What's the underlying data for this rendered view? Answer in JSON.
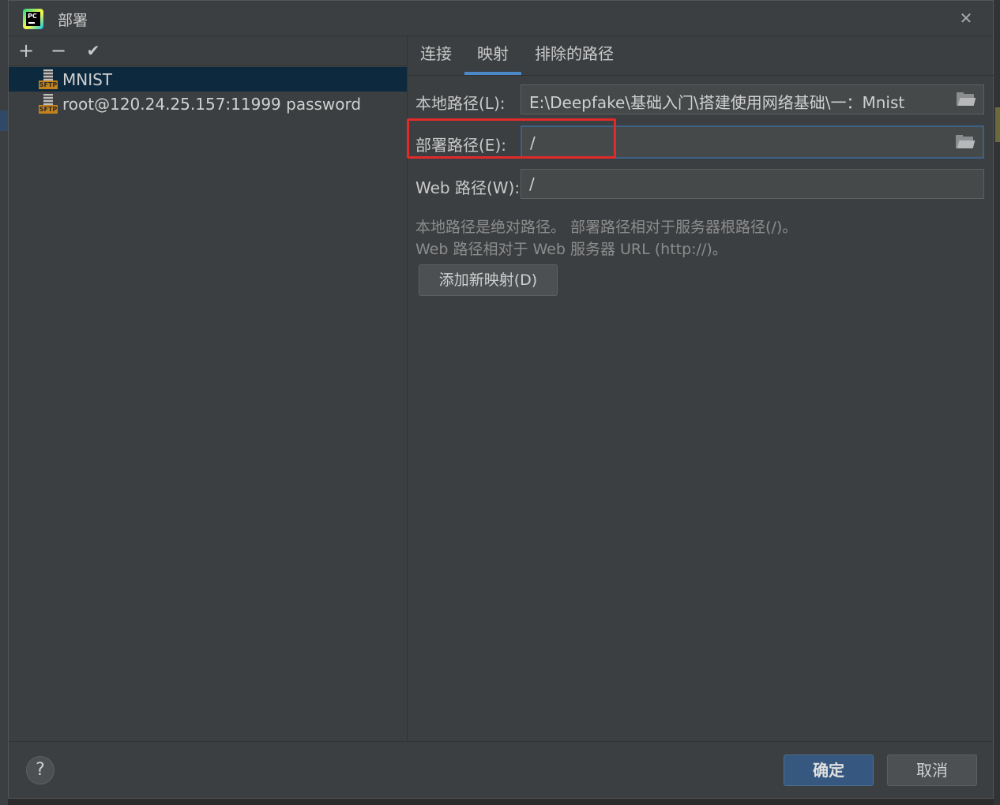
{
  "window": {
    "title": "部署"
  },
  "toolbar": {
    "add": "+",
    "remove": "−",
    "default": "✔"
  },
  "servers": [
    {
      "name": "MNIST",
      "icon": "sftp-icon",
      "selected": true
    },
    {
      "name": "root@120.24.25.157:11999 password",
      "icon": "sftp-icon",
      "selected": false
    }
  ],
  "tabs": [
    {
      "label": "连接",
      "active": false
    },
    {
      "label": "映射",
      "active": true
    },
    {
      "label": "排除的路径",
      "active": false
    }
  ],
  "mapping": {
    "local_path_label": "本地路径(L):",
    "local_path_value": "E:\\Deepfake\\基础入门\\搭建使用网络基础\\一：Mnist",
    "deploy_path_label": "部署路径(E):",
    "deploy_path_value": "/",
    "web_path_label": "Web 路径(W):",
    "web_path_value": "/",
    "hint_line1": "本地路径是绝对路径。 部署路径相对于服务器根路径(/)。",
    "hint_line2": "Web 路径相对于 Web 服务器 URL (http://)。",
    "add_mapping_button": "添加新映射(D)"
  },
  "footer": {
    "help": "?",
    "ok": "确定",
    "cancel": "取消"
  },
  "colors": {
    "accent": "#4a88c7",
    "highlight": "#e12a2a",
    "ok_button": "#365880",
    "selection": "#0d293e"
  }
}
